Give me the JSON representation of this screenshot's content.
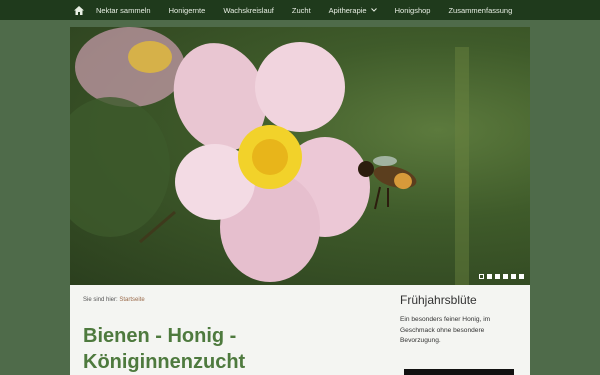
{
  "nav": {
    "items": [
      {
        "label": "Nektar sammeln"
      },
      {
        "label": "Honigernte"
      },
      {
        "label": "Wachskreislauf"
      },
      {
        "label": "Zucht"
      },
      {
        "label": "Apitherapie"
      },
      {
        "label": "Honigshop"
      },
      {
        "label": "Zusammenfassung"
      }
    ]
  },
  "slider": {
    "slide_count": 6,
    "active_slide": 1
  },
  "breadcrumb": {
    "prefix": "Sie sind hier:",
    "current": "Startseite"
  },
  "main": {
    "title": "Bienen - Honig - Königinnenzucht"
  },
  "sidebar": {
    "title": "Frühjahrsblüte",
    "text": "Ein besonders feiner Honig, im Geschmack ohne besondere Bevorzugung."
  },
  "colors": {
    "nav_bg": "#1f3a1c",
    "page_bg": "#4f6b4a",
    "title_green": "#4e7a3e"
  }
}
